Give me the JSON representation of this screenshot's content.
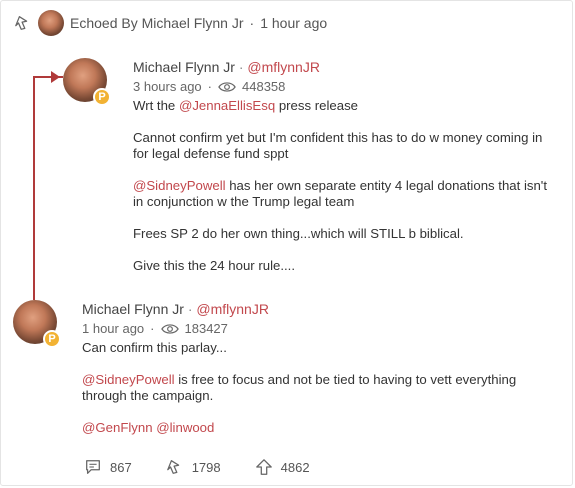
{
  "echo_header": {
    "label": "Echoed By Michael Flynn Jr",
    "separator": "·",
    "time": "1 hour ago"
  },
  "quoted_post": {
    "author_name": "Michael Flynn Jr",
    "separator": "·",
    "handle": "@mflynnJR",
    "time": "3 hours ago",
    "meta_separator": "·",
    "views": "448358",
    "body": {
      "line1_prefix": "Wrt the ",
      "line1_mention": "@JennaEllisEsq",
      "line1_suffix": " press release",
      "para2": "Cannot confirm yet but I'm confident this has to do w money coming in for legal defense fund sppt",
      "para3_mention": "@SidneyPowell",
      "para3_rest": " has her own separate entity 4 legal donations that isn't in conjunction w the Trump legal team",
      "para4": "Frees SP 2 do her own thing...which will STILL b biblical.",
      "para5": "Give this the 24 hour rule...."
    }
  },
  "main_post": {
    "author_name": "Michael Flynn Jr",
    "separator": "·",
    "handle": "@mflynnJR",
    "time": "1 hour ago",
    "meta_separator": "·",
    "views": "183427",
    "body": {
      "para1": "Can confirm this parlay...",
      "para2_mention": "@SidneyPowell",
      "para2_rest": " is free to focus and not be tied to having to vett everything through the campaign.",
      "para3_mention1": "@GenFlynn",
      "para3_space": " ",
      "para3_mention2": "@linwood"
    }
  },
  "actions": {
    "comments": "867",
    "echoes": "1798",
    "upvotes": "4862"
  },
  "badge_letter": "P",
  "colors": {
    "accent_red": "#c2484d",
    "badge_gold": "#f2b233",
    "connector": "#b03a3a"
  },
  "icons": [
    "echo-icon",
    "eye-icon",
    "comment-icon",
    "upvote-icon",
    "verified-badge-icon"
  ]
}
